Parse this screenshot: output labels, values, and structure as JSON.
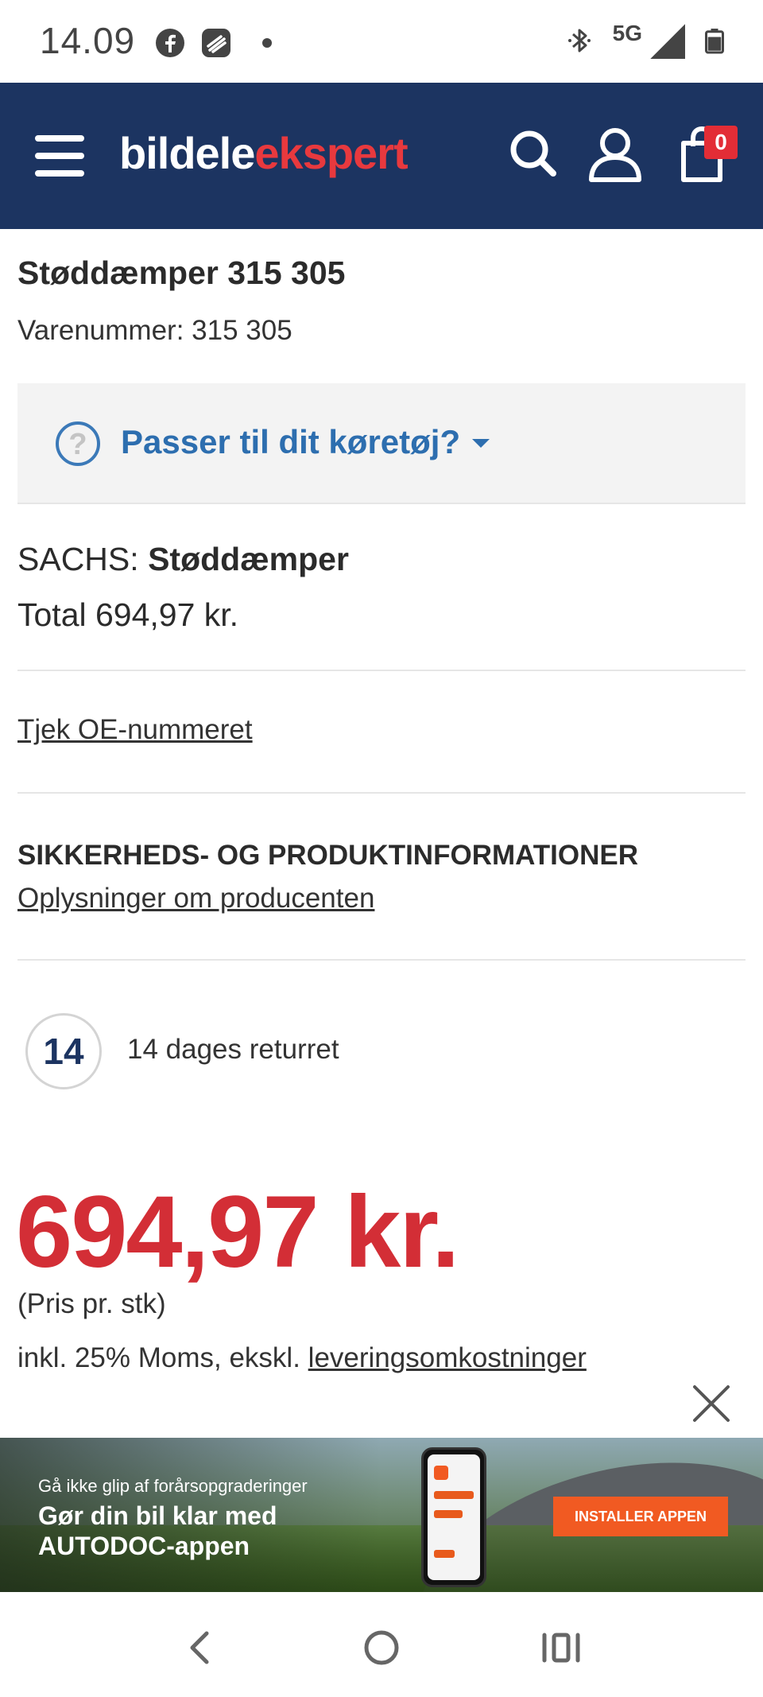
{
  "status_bar": {
    "time": "14.09",
    "network": "5G",
    "icons": [
      "facebook-icon",
      "stack-app-icon",
      "notification-dot",
      "bluetooth-icon",
      "signal-icon",
      "battery-icon"
    ]
  },
  "header": {
    "logo_part1": "bildele",
    "logo_part2": "ekspert",
    "cart_count": "0",
    "bg_color": "#1c3461",
    "accent_color": "#e8393e"
  },
  "product": {
    "title": "Støddæmper 315 305",
    "sku": "Varenummer: 315 305",
    "fit_question": "Passer til dit køretøj?",
    "fit_icon_glyph": "?",
    "brand": "SACHS:",
    "product_type": "Støddæmper",
    "total": "Total 694,97 kr.",
    "oe_link": "Tjek OE-nummeret",
    "safety_heading": "SIKKERHEDS- OG PRODUKTINFORMATIONER",
    "manufacturer_link": "Oplysninger om producenten",
    "return_days": "14",
    "return_text": "14 dages returret",
    "price": "694,97 kr.",
    "price_unit": "(Pris pr. stk)",
    "vat_text": "inkl. 25% Moms, ekskl.",
    "delivery_link": "leveringsomkostninger",
    "price_color": "#d32e36"
  },
  "ad": {
    "small_text": "Gå ikke glip af forårsopgraderinger",
    "headline_1": "Gør din bil klar med",
    "headline_2": "AUTODOC-appen",
    "cta": "INSTALLER APPEN",
    "cta_color": "#f15a22"
  },
  "navbar": {
    "icons": [
      "back-icon",
      "home-icon",
      "recents-icon"
    ]
  }
}
